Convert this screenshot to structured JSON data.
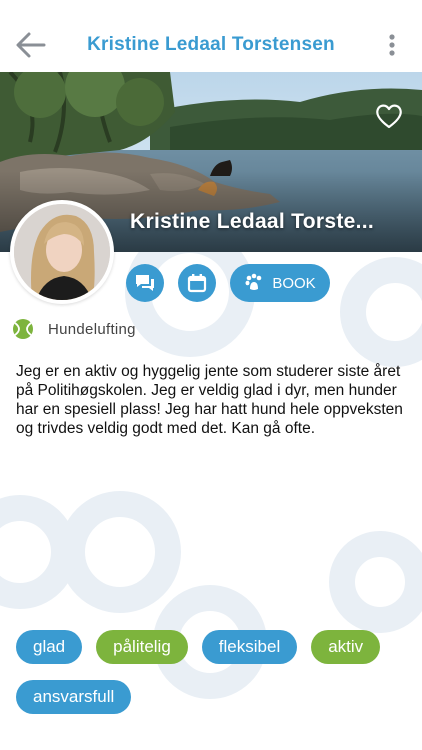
{
  "header": {
    "title": "Kristine Ledaal Torstensen",
    "back_icon": "arrow-left-icon",
    "menu_icon": "kebab-menu-icon"
  },
  "profile": {
    "cover_name": "Kristine Ledaal Torste...",
    "favorite_icon": "heart-icon"
  },
  "actions": {
    "chat_icon": "chat-icon",
    "calendar_icon": "calendar-icon",
    "book_label": "BOOK",
    "book_icon": "paw-icon"
  },
  "service": {
    "icon": "tennis-ball-icon",
    "label": "Hundelufting"
  },
  "description": "Jeg er en aktiv og hyggelig jente som studerer siste året på Politihøgskolen. Jeg er veldig glad i dyr, men hunder har en spesiell plass! Jeg har hatt hund hele oppveksten og trivdes veldig godt med det. Kan gå ofte.",
  "tags": [
    {
      "label": "glad",
      "color": "blue"
    },
    {
      "label": "pålitelig",
      "color": "green"
    },
    {
      "label": "fleksibel",
      "color": "blue"
    },
    {
      "label": "aktiv",
      "color": "green"
    },
    {
      "label": "ansvarsfull",
      "color": "blue"
    }
  ],
  "colors": {
    "accent_blue": "#3a9bd1",
    "accent_green": "#7db43d"
  }
}
